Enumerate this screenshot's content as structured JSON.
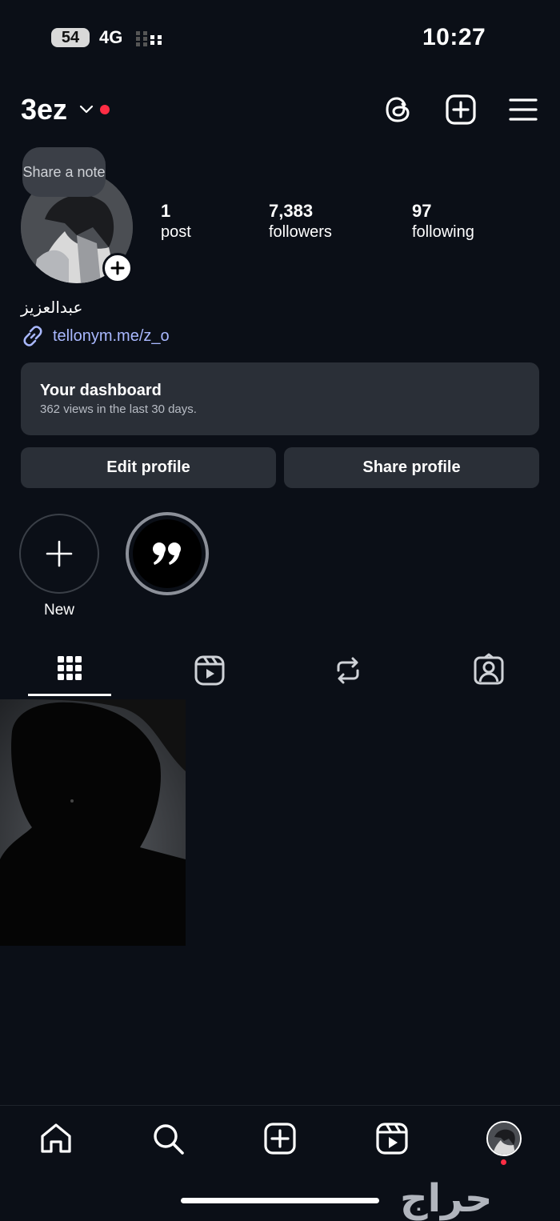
{
  "status_bar": {
    "battery": "54",
    "network": "4G",
    "time": "10:27"
  },
  "header": {
    "username": "3ez"
  },
  "profile": {
    "note_bubble": "Share a note",
    "stats": {
      "posts": {
        "value": "1",
        "label": "post"
      },
      "followers": {
        "value": "7,383",
        "label": "followers"
      },
      "following": {
        "value": "97",
        "label": "following"
      }
    },
    "display_name": "عبدالعزيز",
    "link": "tellonym.me/z_o"
  },
  "dashboard": {
    "title": "Your dashboard",
    "subtitle": "362 views in the last 30 days."
  },
  "buttons": {
    "edit_profile": "Edit profile",
    "share_profile": "Share profile"
  },
  "highlights": {
    "new_label": "New"
  },
  "tabs": [
    "grid-icon",
    "reels-icon",
    "reposts-icon",
    "tagged-icon"
  ],
  "bottom_nav": [
    "home-icon",
    "search-icon",
    "create-icon",
    "reels-icon",
    "profile-avatar"
  ],
  "watermark": "حراج",
  "colors": {
    "background": "#0b0f17",
    "surface": "#2a2f37",
    "link": "#a9b8ff",
    "notification_dot": "#ff2d44"
  }
}
